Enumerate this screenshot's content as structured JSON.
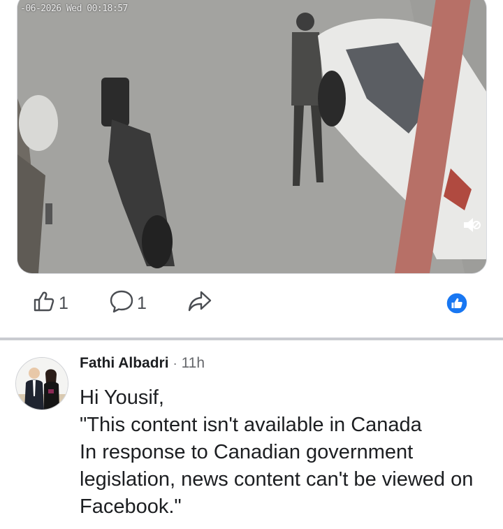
{
  "video": {
    "timestamp": "-06-2026 Wed 00:18:57",
    "mute_icon": "speaker-muted-icon"
  },
  "actions": {
    "like_count": "1",
    "comment_count": "1",
    "like_icon": "thumbs-up-icon",
    "comment_icon": "comment-bubble-icon",
    "share_icon": "share-arrow-icon",
    "reaction_icon": "like-reaction-icon",
    "reaction_color": "#1877f2"
  },
  "comment": {
    "author": "Fathi Albadri",
    "separator": "·",
    "time": "11h",
    "text": "Hi Yousif,\n\"This content isn't available in Canada\nIn response to Canadian government legislation, news content can't be viewed on Facebook.\""
  }
}
